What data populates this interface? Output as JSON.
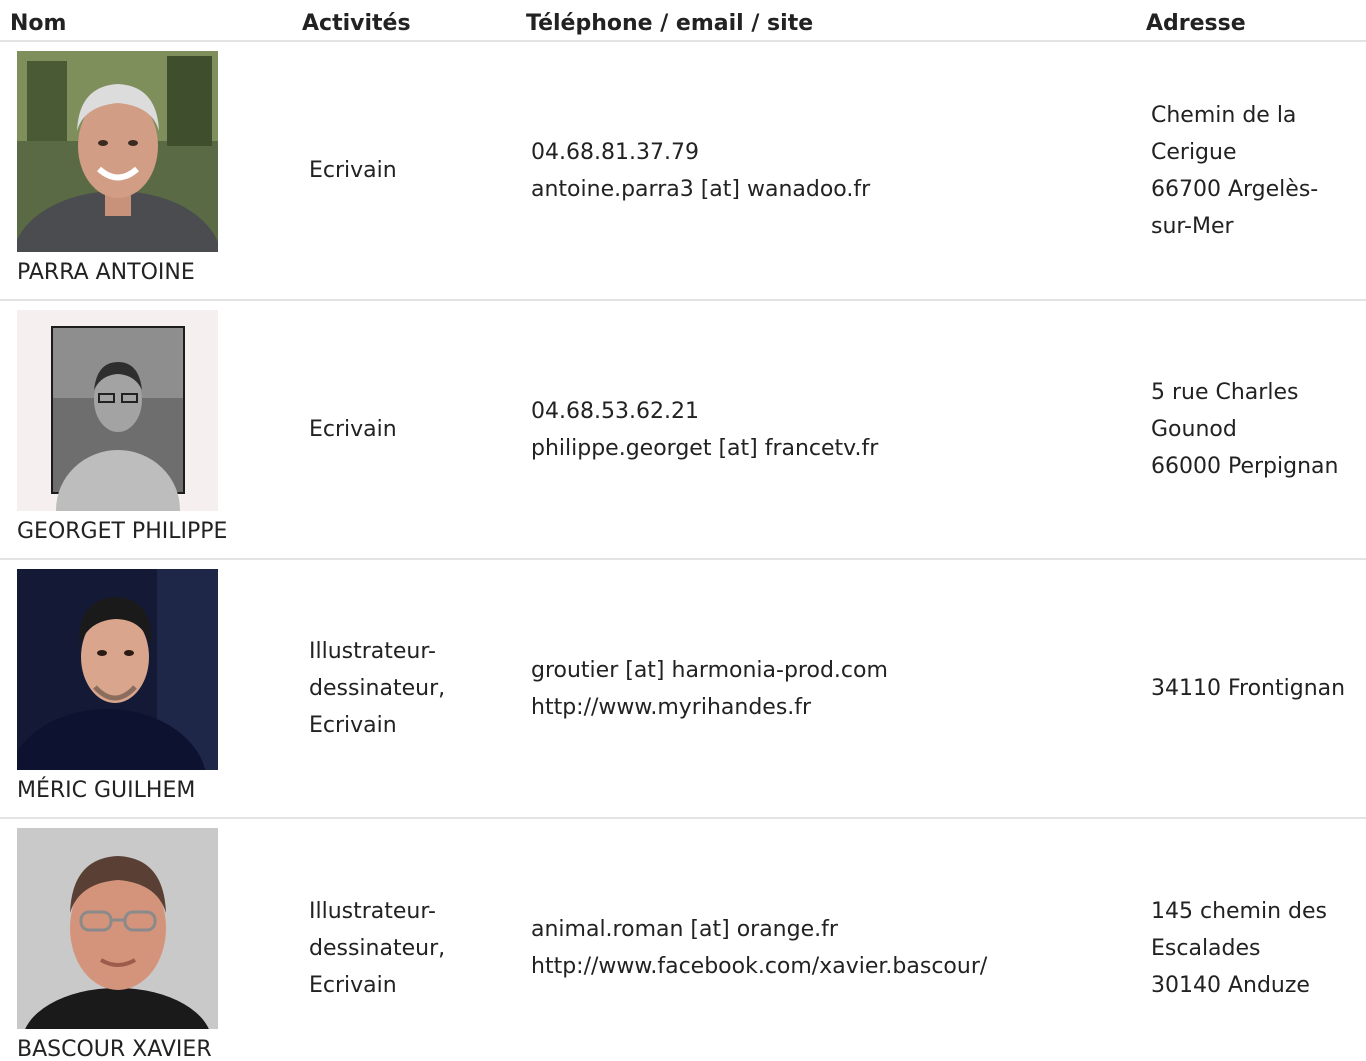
{
  "headers": {
    "nom": "Nom",
    "activites": "Activités",
    "contact": "Téléphone / email / site",
    "adresse": "Adresse"
  },
  "people": [
    {
      "name": "PARRA ANTOINE",
      "photo_icon": "portrait-photo",
      "activity": [
        "Ecrivain"
      ],
      "contact": [
        "04.68.81.37.79",
        "antoine.parra3 [at] wanadoo.fr"
      ],
      "address": [
        "Chemin de la",
        "Cerigue",
        "66700 Argelès-",
        "sur-Mer"
      ]
    },
    {
      "name": "GEORGET PHILIPPE",
      "photo_icon": "portrait-photo",
      "activity": [
        "Ecrivain"
      ],
      "contact": [
        "04.68.53.62.21",
        "philippe.georget [at] francetv.fr"
      ],
      "address": [
        "5 rue Charles",
        "Gounod",
        "66000 Perpignan"
      ]
    },
    {
      "name": "MÉRIC GUILHEM",
      "photo_icon": "portrait-photo",
      "activity": [
        "Illustrateur-",
        "dessinateur,",
        "Ecrivain"
      ],
      "contact": [
        "groutier [at] harmonia-prod.com",
        "http://www.myrihandes.fr"
      ],
      "address": [
        "34110 Frontignan"
      ]
    },
    {
      "name": "BASCOUR XAVIER",
      "photo_icon": "portrait-photo",
      "activity": [
        "Illustrateur-",
        "dessinateur,",
        "Ecrivain"
      ],
      "contact": [
        "animal.roman [at] orange.fr",
        "http://www.facebook.com/xavier.bascour/"
      ],
      "address": [
        "145 chemin des",
        "Escalades",
        "30140 Anduze"
      ]
    }
  ]
}
